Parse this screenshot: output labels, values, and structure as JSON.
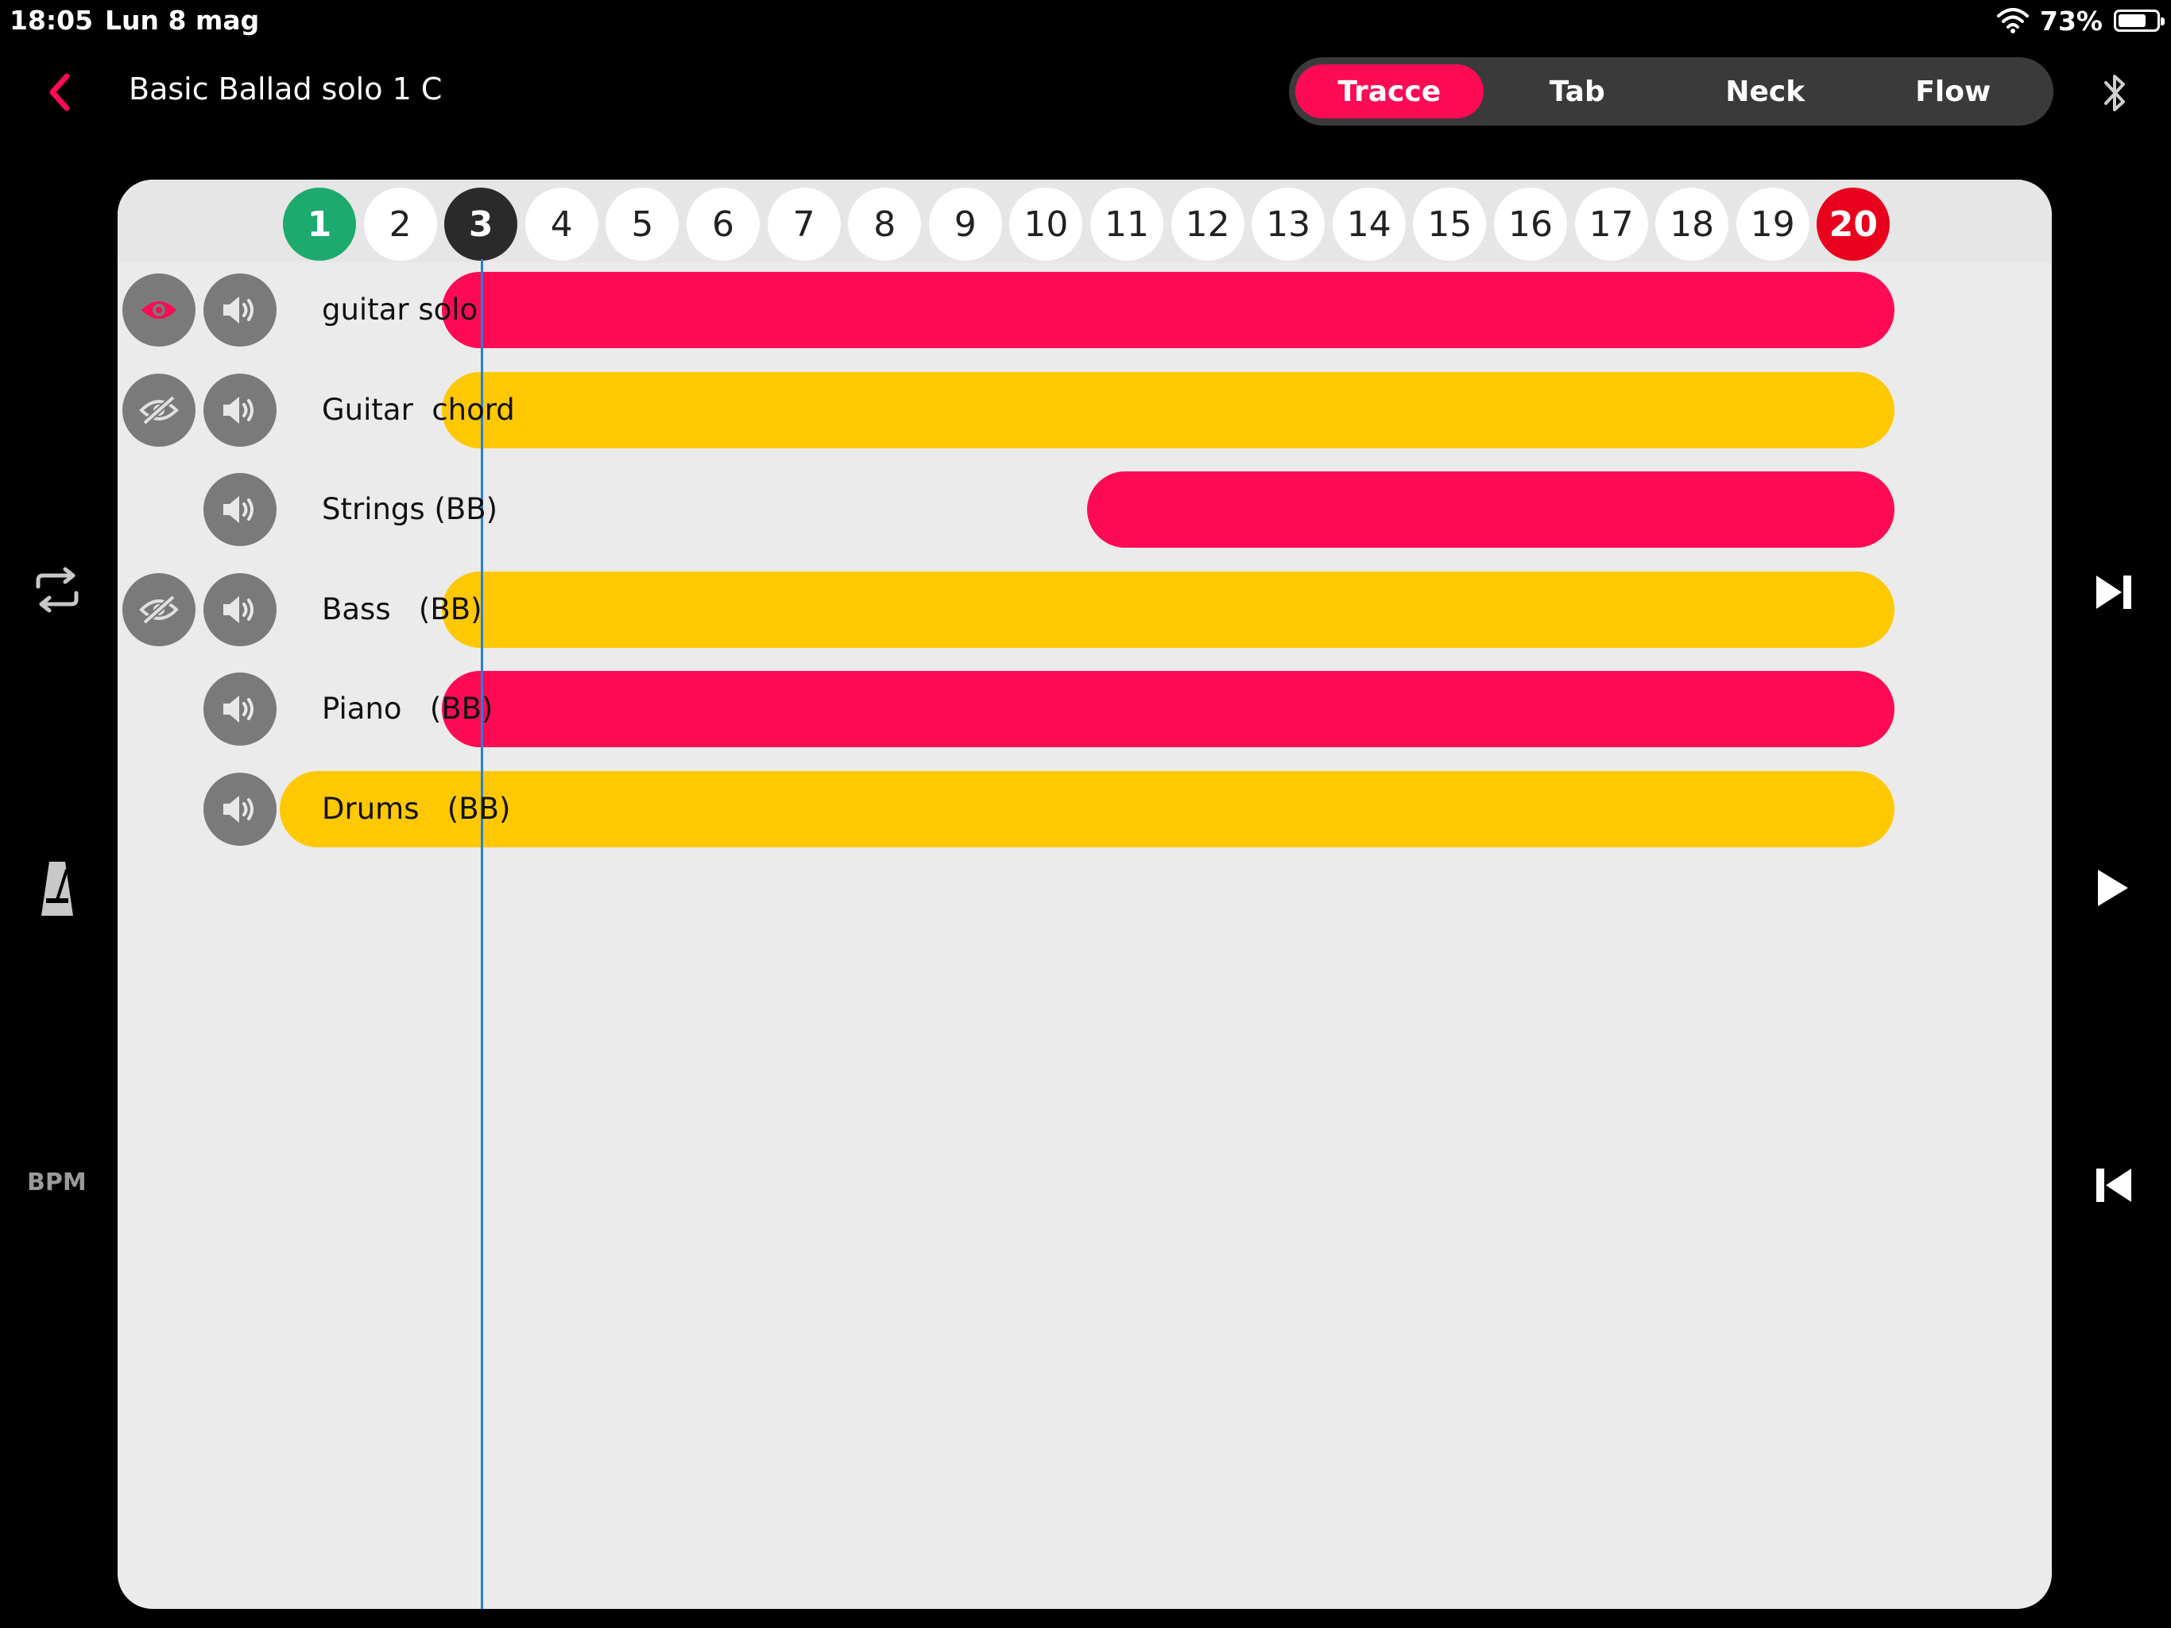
{
  "status": {
    "time": "18:05",
    "date": "Lun 8 mag",
    "battery": "73%",
    "battery_level": 0.73
  },
  "header": {
    "title": "Basic Ballad solo 1 C",
    "tabs": [
      {
        "label": "Tracce",
        "active": true
      },
      {
        "label": "Tab",
        "active": false
      },
      {
        "label": "Neck",
        "active": false
      },
      {
        "label": "Flow",
        "active": false
      }
    ]
  },
  "side": {
    "bpm_label": "BPM"
  },
  "bars": [
    "1",
    "2",
    "3",
    "4",
    "5",
    "6",
    "7",
    "8",
    "9",
    "10",
    "11",
    "12",
    "13",
    "14",
    "15",
    "16",
    "17",
    "18",
    "19",
    "20"
  ],
  "current_bar": 3,
  "tracks": [
    {
      "name": "guitar solo",
      "visibility": "visible",
      "color": "#ff0a55"
    },
    {
      "name": "Guitar  chord",
      "visibility": "hidden",
      "color": "#ffc800"
    },
    {
      "name": "Strings (BB)",
      "visibility": "none",
      "color": "#ff0a55"
    },
    {
      "name": "Bass   (BB)",
      "visibility": "hidden",
      "color": "#ffc800"
    },
    {
      "name": "Piano   (BB)",
      "visibility": "none",
      "color": "#ff0a55"
    },
    {
      "name": "Drums   (BB)",
      "visibility": "none",
      "color": "#ffc800"
    }
  ],
  "colors": {
    "accent": "#ff0a55",
    "yellow": "#ffc800",
    "start_bar": "#1daa6e",
    "end_bar": "#e8001c",
    "playhead": "#2a7fd9"
  }
}
